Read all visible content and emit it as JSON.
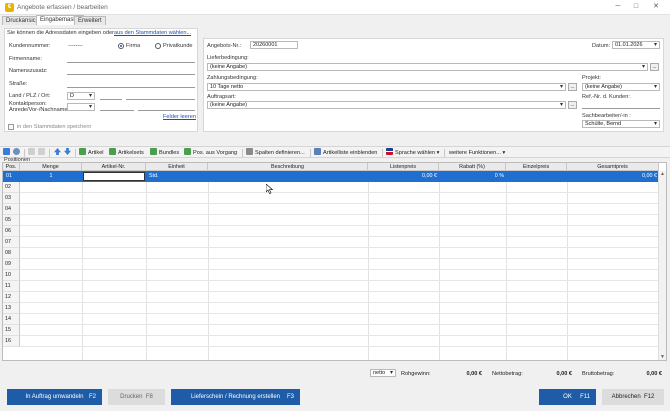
{
  "window": {
    "title": "Angebote erfassen / bearbeiten",
    "minimize": "─",
    "maximize": "□",
    "close": "✕"
  },
  "tabs": [
    "Druckansicht",
    "Eingabemaske",
    "Erweitert"
  ],
  "customer": {
    "hint": "Sie können die Adressdaten eingeben oder",
    "hint_link": "aus den Stammdaten wählen...",
    "kundennummer_label": "Kundennummer:",
    "kundennummer_value": "--------",
    "radio_firma": "Firma",
    "radio_privat": "Privatkunde",
    "firmenname_label": "Firmenname:",
    "namenszusatz_label": "Namenszusatz:",
    "strasse_label": "Straße:",
    "land_label": "Land / PLZ / Ort:",
    "land_value": "D",
    "kontakt_label_1": "Kontaktperson:",
    "kontakt_label_2": "Anrede/Vor-/Nachname",
    "felder_leeren": "Felder leeren",
    "save_checkbox": "in den Stammdaten speichern"
  },
  "offer": {
    "nr_label": "Angebots-Nr.:",
    "nr_value": "20260001",
    "datum_label": "Datum:",
    "datum_value": "01.01.2026",
    "liefer_label": "Lieferbedingung:",
    "liefer_value": "(keine Angabe)",
    "zahlung_label": "Zahlungsbedingung:",
    "zahlung_value": "10 Tage netto",
    "auftrag_label": "Auftragsart:",
    "auftrag_value": "(keine Angabe)",
    "projekt_label": "Projekt:",
    "projekt_value": "(keine Angabe)",
    "refnr_label": "Ref.-Nr. d. Kunden:",
    "sachbearbeiter_label": "Sachbearbeiter/-in :",
    "sachbearbeiter_value": "Schülte, Bernd",
    "more": "..."
  },
  "positions_label": "Positionen",
  "toolbar": {
    "artikel": "Artikel",
    "artikelsets": "Artikelsets",
    "bundles": "Bundles",
    "pos_vorgang": "Pos. aus Vorgang",
    "spalten": "Spalten definieren...",
    "artikelliste": "Artikelliste einblenden",
    "sprache": "Sprache wählen",
    "weitere": "weitere Funktionen..."
  },
  "grid": {
    "headers": [
      "Pos.",
      "Menge",
      "Artikel-Nr.",
      "Einheit",
      "Beschreibung",
      "Listenpreis",
      "Rabatt (%)",
      "Einzelpreis",
      "Gesamtpreis"
    ],
    "row1": {
      "pos": "01",
      "menge": "1",
      "einheit": "Std.",
      "listenpreis": "0,00 €",
      "rabatt": "0 %",
      "gesamtpreis": "0,00 €"
    },
    "row_numbers": [
      "02",
      "03",
      "04",
      "05",
      "06",
      "07",
      "08",
      "09",
      "10",
      "11",
      "12",
      "13",
      "14",
      "15",
      "16"
    ]
  },
  "totals": {
    "mode": "netto",
    "rohgewinn_label": "Rohgewinn:",
    "rohgewinn_value": "0,00 €",
    "netto_label": "Nettobetrag:",
    "netto_value": "0,00 €",
    "brutto_label": "Bruttobetrag:",
    "brutto_value": "0,00 €"
  },
  "buttons": {
    "auftrag": "In Auftrag umwandeln",
    "auftrag_key": "F2",
    "drucken": "Drucken",
    "drucken_key": "F8",
    "lieferschein": "Lieferschein / Rechnung erstellen",
    "lieferschein_key": "F3",
    "ok": "OK",
    "ok_key": "F11",
    "abbrechen": "Abbrechen",
    "abbrechen_key": "F12"
  },
  "colors": {
    "accent": "#1f5ca8",
    "selection": "#1f6fd1",
    "brand": "#e8b400"
  }
}
